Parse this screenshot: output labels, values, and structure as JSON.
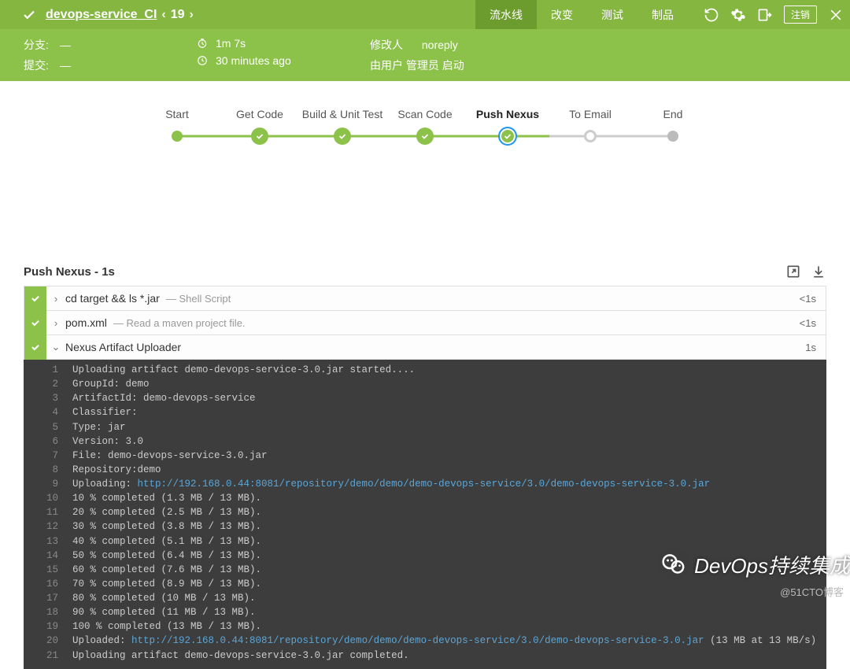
{
  "header": {
    "job_name": "devops-service_CI",
    "run_number": "19",
    "tabs": [
      "流水线",
      "改变",
      "测试",
      "制品"
    ],
    "active_tab": 0,
    "logout": "注销"
  },
  "meta": {
    "branch_label": "分支:",
    "branch_value": "—",
    "commit_label": "提交:",
    "commit_value": "—",
    "duration": "1m 7s",
    "age": "30 minutes ago",
    "changed_by_label": "修改人",
    "changed_by_value": "noreply",
    "started_by": "由用户 管理员 启动"
  },
  "pipeline": {
    "stages": [
      {
        "label": "Start",
        "type": "dot-green"
      },
      {
        "label": "Get Code",
        "type": "success"
      },
      {
        "label": "Build & Unit Test",
        "type": "success"
      },
      {
        "label": "Scan Code",
        "type": "success"
      },
      {
        "label": "Push Nexus",
        "type": "current"
      },
      {
        "label": "To Email",
        "type": "hollow"
      },
      {
        "label": "End",
        "type": "dot-grey"
      }
    ]
  },
  "section": {
    "title": "Push Nexus - 1s"
  },
  "steps": [
    {
      "name": "cd target && ls *.jar",
      "desc": "— Shell Script",
      "dur": "<1s",
      "expanded": false
    },
    {
      "name": "pom.xml",
      "desc": "— Read a maven project file.",
      "dur": "<1s",
      "expanded": false
    },
    {
      "name": "Nexus Artifact Uploader",
      "desc": "",
      "dur": "1s",
      "expanded": true
    }
  ],
  "console": [
    {
      "n": "1",
      "t": "Uploading artifact demo-devops-service-3.0.jar started...."
    },
    {
      "n": "2",
      "t": "GroupId: demo"
    },
    {
      "n": "3",
      "t": "ArtifactId: demo-devops-service"
    },
    {
      "n": "4",
      "t": "Classifier:"
    },
    {
      "n": "5",
      "t": "Type: jar"
    },
    {
      "n": "6",
      "t": "Version: 3.0"
    },
    {
      "n": "7",
      "t": "File: demo-devops-service-3.0.jar"
    },
    {
      "n": "8",
      "t": "Repository:demo"
    },
    {
      "n": "9",
      "t": "Uploading: ",
      "link": "http://192.168.0.44:8081/repository/demo/demo/demo-devops-service/3.0/demo-devops-service-3.0.jar"
    },
    {
      "n": "10",
      "t": "10 % completed (1.3 MB / 13 MB)."
    },
    {
      "n": "11",
      "t": "20 % completed (2.5 MB / 13 MB)."
    },
    {
      "n": "12",
      "t": "30 % completed (3.8 MB / 13 MB)."
    },
    {
      "n": "13",
      "t": "40 % completed (5.1 MB / 13 MB)."
    },
    {
      "n": "14",
      "t": "50 % completed (6.4 MB / 13 MB)."
    },
    {
      "n": "15",
      "t": "60 % completed (7.6 MB / 13 MB)."
    },
    {
      "n": "16",
      "t": "70 % completed (8.9 MB / 13 MB)."
    },
    {
      "n": "17",
      "t": "80 % completed (10 MB / 13 MB)."
    },
    {
      "n": "18",
      "t": "90 % completed (11 MB / 13 MB)."
    },
    {
      "n": "19",
      "t": "100 % completed (13 MB / 13 MB)."
    },
    {
      "n": "20",
      "t": "Uploaded: ",
      "link": "http://192.168.0.44:8081/repository/demo/demo/demo-devops-service/3.0/demo-devops-service-3.0.jar",
      "tail": " (13 MB at 13 MB/s)"
    },
    {
      "n": "21",
      "t": "Uploading artifact demo-devops-service-3.0.jar completed."
    }
  ],
  "watermark": {
    "text": "DevOps持续集成",
    "attribution": "@51CTO博客"
  }
}
